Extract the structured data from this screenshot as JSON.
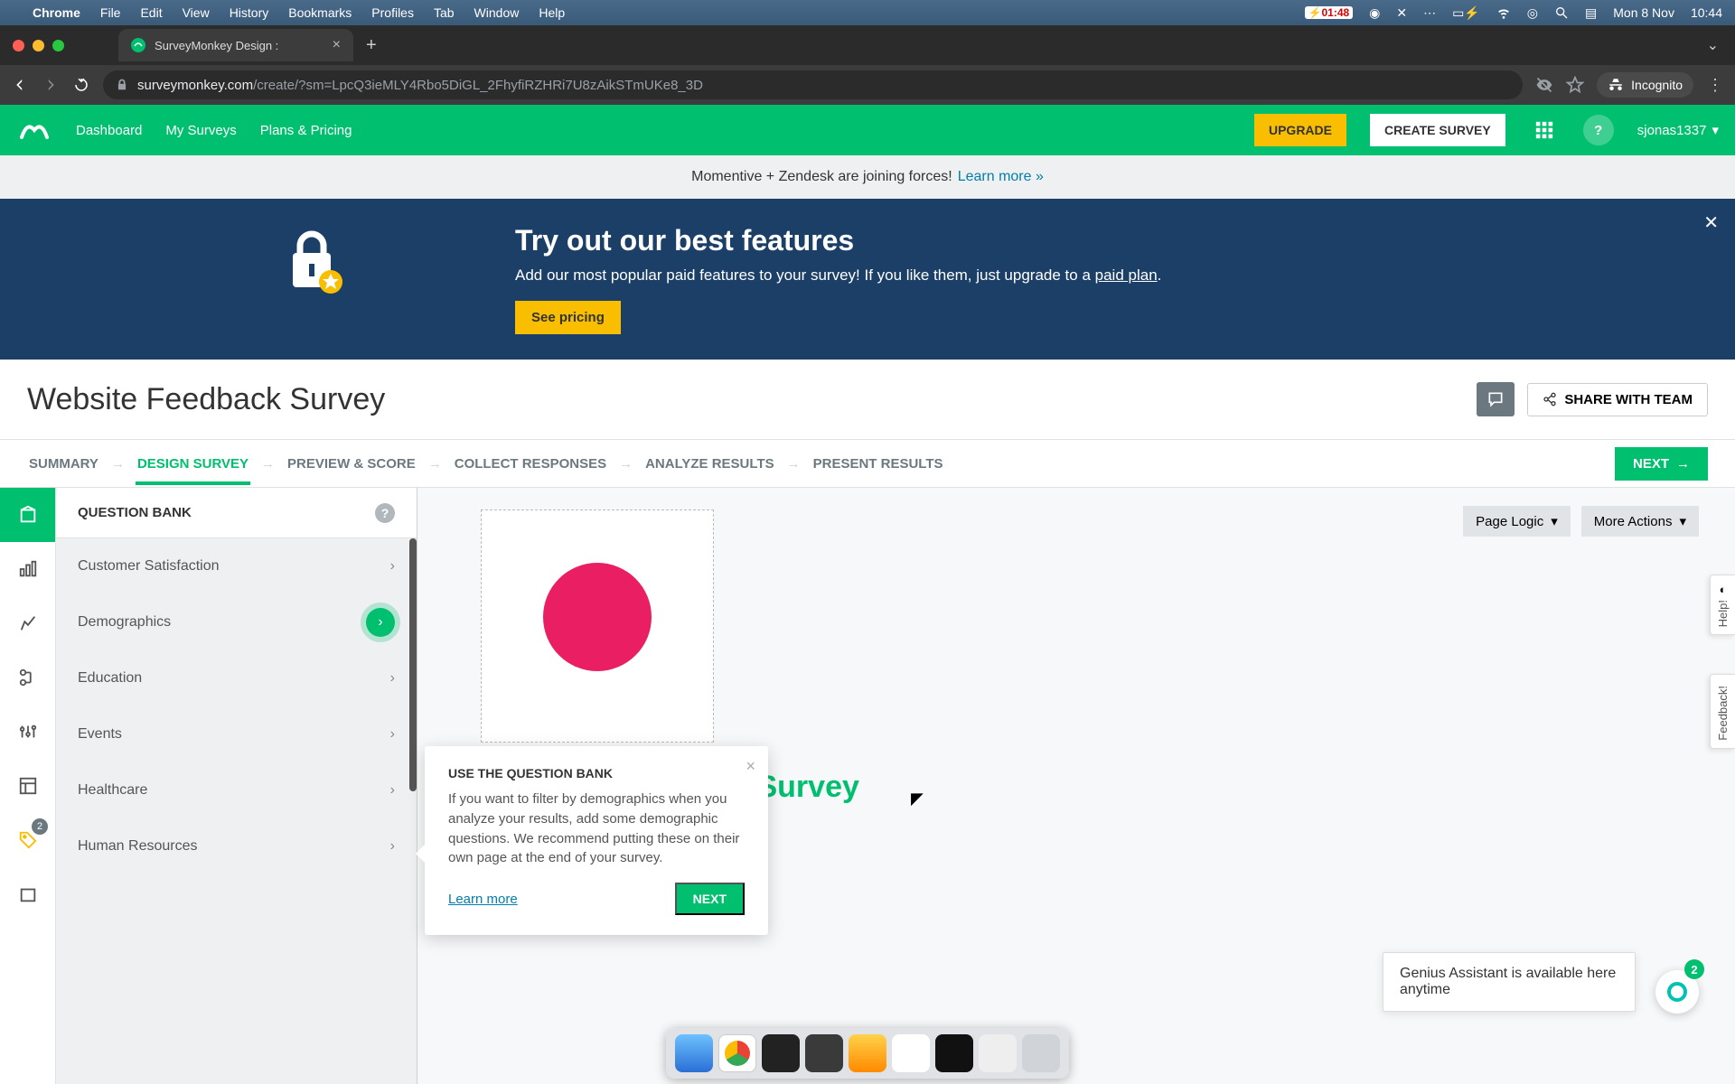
{
  "mac": {
    "app": "Chrome",
    "menus": [
      "File",
      "Edit",
      "View",
      "History",
      "Bookmarks",
      "Profiles",
      "Tab",
      "Window",
      "Help"
    ],
    "battery": "01:48",
    "date": "Mon 8 Nov",
    "time": "10:44"
  },
  "tab": {
    "title": "SurveyMonkey Design :"
  },
  "url": {
    "host": "surveymonkey.com",
    "path": "/create/?sm=LpcQ3ieMLY4Rbo5DiGL_2FhyfiRZHRi7U8zAikSTmUKe8_3D"
  },
  "incognito": "Incognito",
  "header": {
    "links": [
      "Dashboard",
      "My Surveys",
      "Plans & Pricing"
    ],
    "upgrade": "UPGRADE",
    "create": "CREATE SURVEY",
    "user": "sjonas1337"
  },
  "announce": {
    "text": "Momentive + Zendesk are joining forces!",
    "link": "Learn more »"
  },
  "promo": {
    "title": "Try out our best features",
    "body_pre": "Add our most popular paid features to your survey! If you like them, just upgrade to a ",
    "body_link": "paid plan",
    "body_post": ".",
    "cta": "See pricing"
  },
  "title": "Website Feedback Survey",
  "share": "SHARE WITH TEAM",
  "tabs": {
    "items": [
      "SUMMARY",
      "DESIGN SURVEY",
      "PREVIEW & SCORE",
      "COLLECT RESPONSES",
      "ANALYZE RESULTS",
      "PRESENT RESULTS"
    ],
    "active": 1,
    "next": "NEXT"
  },
  "leftrail_badge": "2",
  "qbank": {
    "header": "QUESTION BANK",
    "items": [
      "Customer Satisfaction",
      "Demographics",
      "Education",
      "Events",
      "Healthcare",
      "Human Resources"
    ],
    "highlight_index": 1
  },
  "canvas": {
    "page_logic": "Page Logic",
    "more_actions": "More Actions",
    "survey_title": "Website Feedback Survey"
  },
  "popover": {
    "title": "USE THE QUESTION BANK",
    "body": "If you want to filter by demographics when you analyze your results, add some demographic questions. We recommend putting these on their own page at the end of your survey.",
    "learn": "Learn more",
    "next": "NEXT"
  },
  "sidetabs": {
    "help": "Help!",
    "feedback": "Feedback!"
  },
  "genius": {
    "text": "Genius Assistant is available here anytime",
    "badge": "2"
  }
}
